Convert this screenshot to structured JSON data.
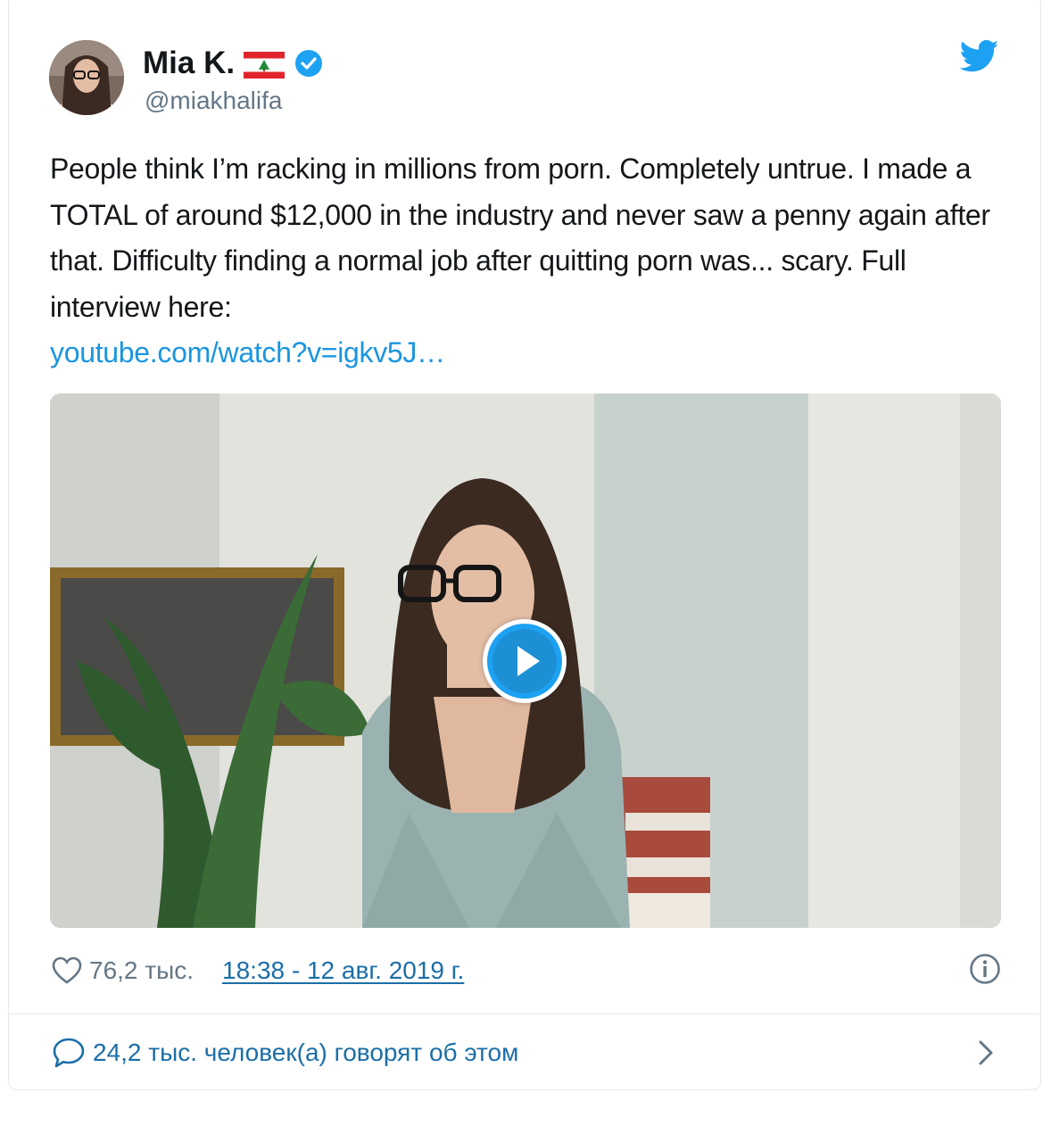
{
  "tweet": {
    "author_name": "Mia K.",
    "handle": "@miakhalifa",
    "text": "People think I’m racking in millions from porn. Completely untrue. I made a TOTAL of around $12,000 in the industry and never saw a penny again after that. Difficulty finding a normal job after quitting porn was... scary. Full interview here:",
    "link": "youtube.com/watch?v=igkv5J…",
    "likes": "76,2 тыс.",
    "timestamp": "18:38 - 12 авг. 2019 г.",
    "conversation": "24,2 тыс. человек(а) говорят об этом"
  },
  "icons": {
    "flag": "lebanon-flag-icon",
    "verified": "verified-badge-icon",
    "brand": "twitter-bird-icon",
    "like": "heart-icon",
    "info": "info-icon",
    "reply": "speech-bubble-icon",
    "more": "chevron-right-icon",
    "play": "play-icon"
  },
  "colors": {
    "link": "#1b95e0",
    "twitter_blue": "#1da1f2",
    "secondary_text": "#657786"
  }
}
